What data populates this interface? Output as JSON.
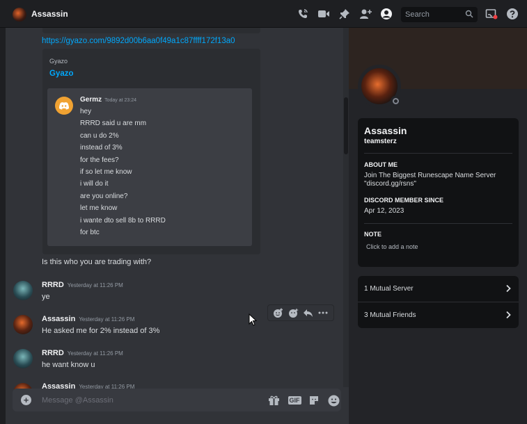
{
  "header": {
    "title": "Assassin",
    "search_placeholder": "Search",
    "icons": [
      "avatar",
      "call-icon",
      "video-icon",
      "pin-icon",
      "add-member-icon",
      "profile-icon",
      "search-icon",
      "inbox-icon",
      "help-icon"
    ]
  },
  "chat": {
    "link": "https://gyazo.com/9892d00b6aa0f49a1c87ffff172f13a0",
    "embed": {
      "provider": "Gyazo",
      "title": "Gyazo",
      "screenshot": {
        "author": "Germz",
        "time": "Today at 23:24",
        "lines": [
          "hey",
          "RRRD said u are mm",
          "can u do 2%",
          "instead of 3%",
          "for the fees?",
          "if so let me know",
          "i will do it",
          "are you online?",
          "let me know",
          "i wante dto sell 8b to RRRD",
          "for btc"
        ]
      }
    },
    "followup": "Is this who you are trading with?",
    "messages": [
      {
        "author": "RRRD",
        "time": "Yesterday at 11:26 PM",
        "text": "ye"
      },
      {
        "author": "Assassin",
        "time": "Yesterday at 11:26 PM",
        "text": "He asked me for 2% instead of 3%"
      },
      {
        "author": "RRRD",
        "time": "Yesterday at 11:26 PM",
        "text": "he want know u"
      },
      {
        "author": "Assassin",
        "time": "Yesterday at 11:26 PM",
        "text": ""
      }
    ],
    "hover_actions": [
      "add-reaction-icon",
      "super-reaction-icon",
      "reply-icon",
      "more-icon"
    ]
  },
  "composer": {
    "placeholder": "Message @Assassin",
    "gif_label": "GIF"
  },
  "profile": {
    "display_name": "Assassin",
    "username": "teamsterz",
    "about_heading": "ABOUT ME",
    "about_text": "Join The Biggest Runescape Name Server \"discord.gg/rsns\"",
    "member_since_heading": "DISCORD MEMBER SINCE",
    "member_since": "Apr 12, 2023",
    "note_heading": "NOTE",
    "note_placeholder": "Click to add a note",
    "mutual_servers": "1 Mutual Server",
    "mutual_friends": "3 Mutual Friends"
  },
  "colors": {
    "link": "#00a8fc",
    "background": "#313338",
    "sidebar": "#232428",
    "embed_avatar": "#f0a232"
  }
}
